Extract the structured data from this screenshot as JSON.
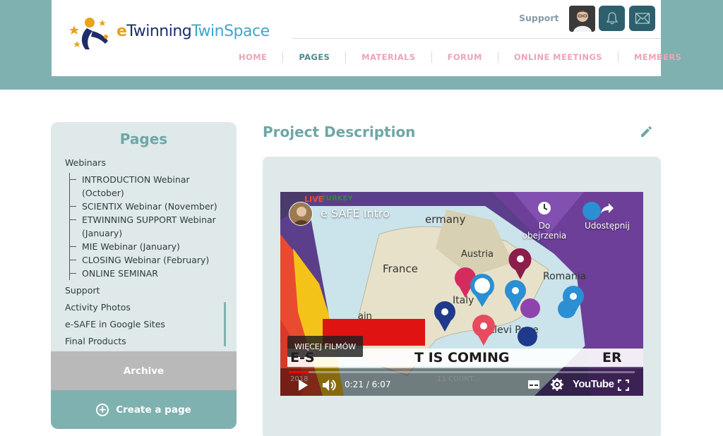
{
  "header": {
    "logo": {
      "e": "e",
      "twinning": "Twinning",
      "twinspace": "TwinSpace"
    },
    "support": "Support",
    "icons": {
      "bell": "bell-icon",
      "mail": "mail-icon",
      "avatar": "user-avatar"
    }
  },
  "nav": {
    "items": [
      "HOME",
      "PAGES",
      "MATERIALS",
      "FORUM",
      "ONLINE MEETINGS",
      "MEMBERS"
    ],
    "active": "PAGES"
  },
  "sidebar": {
    "title": "Pages",
    "webinars_label": "Webinars",
    "webinars": [
      "INTRODUCTION Webinar (October)",
      "SCIENTIX Webinar (November)",
      "ETWINNING SUPPORT Webinar (January)",
      "MIE Webinar (January)",
      "CLOSING Webinar (February)",
      "ONLINE SEMINAR"
    ],
    "pages": [
      "Support",
      "Activity Photos",
      "e-SAFE in Google Sites",
      "Final Products"
    ],
    "archive": "Archive",
    "create": "Create a page"
  },
  "main": {
    "title": "Project Description",
    "video": {
      "title": "e SAFE Intro",
      "watch_later": "Do obejrzenia",
      "share": "Udostępnij",
      "more_videos": "WIĘCEJ FILMÓW",
      "time": "0:21 / 6:07",
      "progress": 0.057,
      "brand": "YouTube",
      "overlay_map_labels": [
        "France",
        "Austria",
        "Italy",
        "Romania",
        "Klevi Pove"
      ],
      "overlay_banner": "E-S... T IS COMING ... ER",
      "overlay_corner": "LIVE TURKEY",
      "overlay_year": "2018",
      "overlay_countries": "11 COUNT..."
    }
  },
  "colors": {
    "teal": "#7fb1b0",
    "teal_dark": "#2e5f6d",
    "panel": "#dfe9e9",
    "nav_pink": "#eca5b6",
    "nav_active": "#4b8b8c"
  }
}
